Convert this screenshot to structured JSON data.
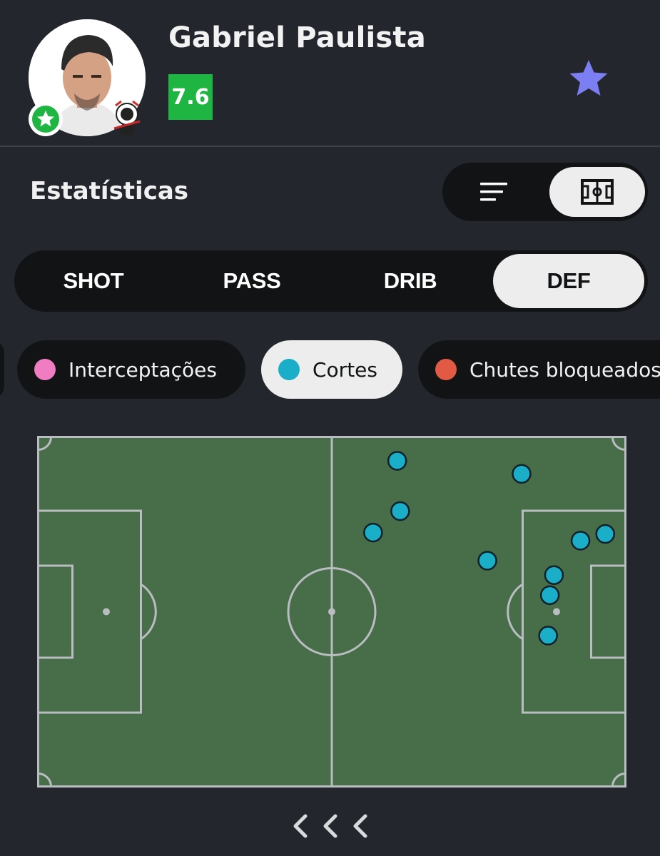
{
  "player": {
    "name": "Gabriel Paulista",
    "rating": "7.6",
    "rating_color": "#1fb542",
    "avatar_icon": "player-photo",
    "badge_icon": "star-badge-icon",
    "club_icon": "club-crest-icon"
  },
  "header": {
    "follow_icon": "star-icon",
    "follow_color": "#7b7ff2"
  },
  "stats": {
    "title": "Estatísticas",
    "view_toggle": [
      {
        "icon": "list-icon",
        "active": false
      },
      {
        "icon": "pitch-icon",
        "active": true
      }
    ]
  },
  "tabs": [
    {
      "label": "SHOT",
      "active": false
    },
    {
      "label": "PASS",
      "active": false
    },
    {
      "label": "DRIB",
      "active": false
    },
    {
      "label": "DEF",
      "active": true
    }
  ],
  "filters": [
    {
      "label": "Interceptações",
      "color": "#f07dc2",
      "active": false
    },
    {
      "label": "Cortes",
      "color": "#1aaec8",
      "active": true
    },
    {
      "label": "Chutes bloqueados",
      "color": "#e25a43",
      "active": false
    }
  ],
  "pitch": {
    "pitch_color": "#476e48",
    "line_color": "#b9bcc0",
    "marker_color": "#1aaec8",
    "events": [
      {
        "x": 61.1,
        "y": 7.1
      },
      {
        "x": 82.2,
        "y": 10.8
      },
      {
        "x": 61.6,
        "y": 21.4
      },
      {
        "x": 57.0,
        "y": 27.5
      },
      {
        "x": 96.4,
        "y": 27.9
      },
      {
        "x": 92.2,
        "y": 29.8
      },
      {
        "x": 76.4,
        "y": 35.5
      },
      {
        "x": 87.7,
        "y": 39.6
      },
      {
        "x": 87.0,
        "y": 45.3
      },
      {
        "x": 86.7,
        "y": 56.8
      }
    ]
  },
  "pager": {
    "icon": "chevrons-left-icon"
  }
}
